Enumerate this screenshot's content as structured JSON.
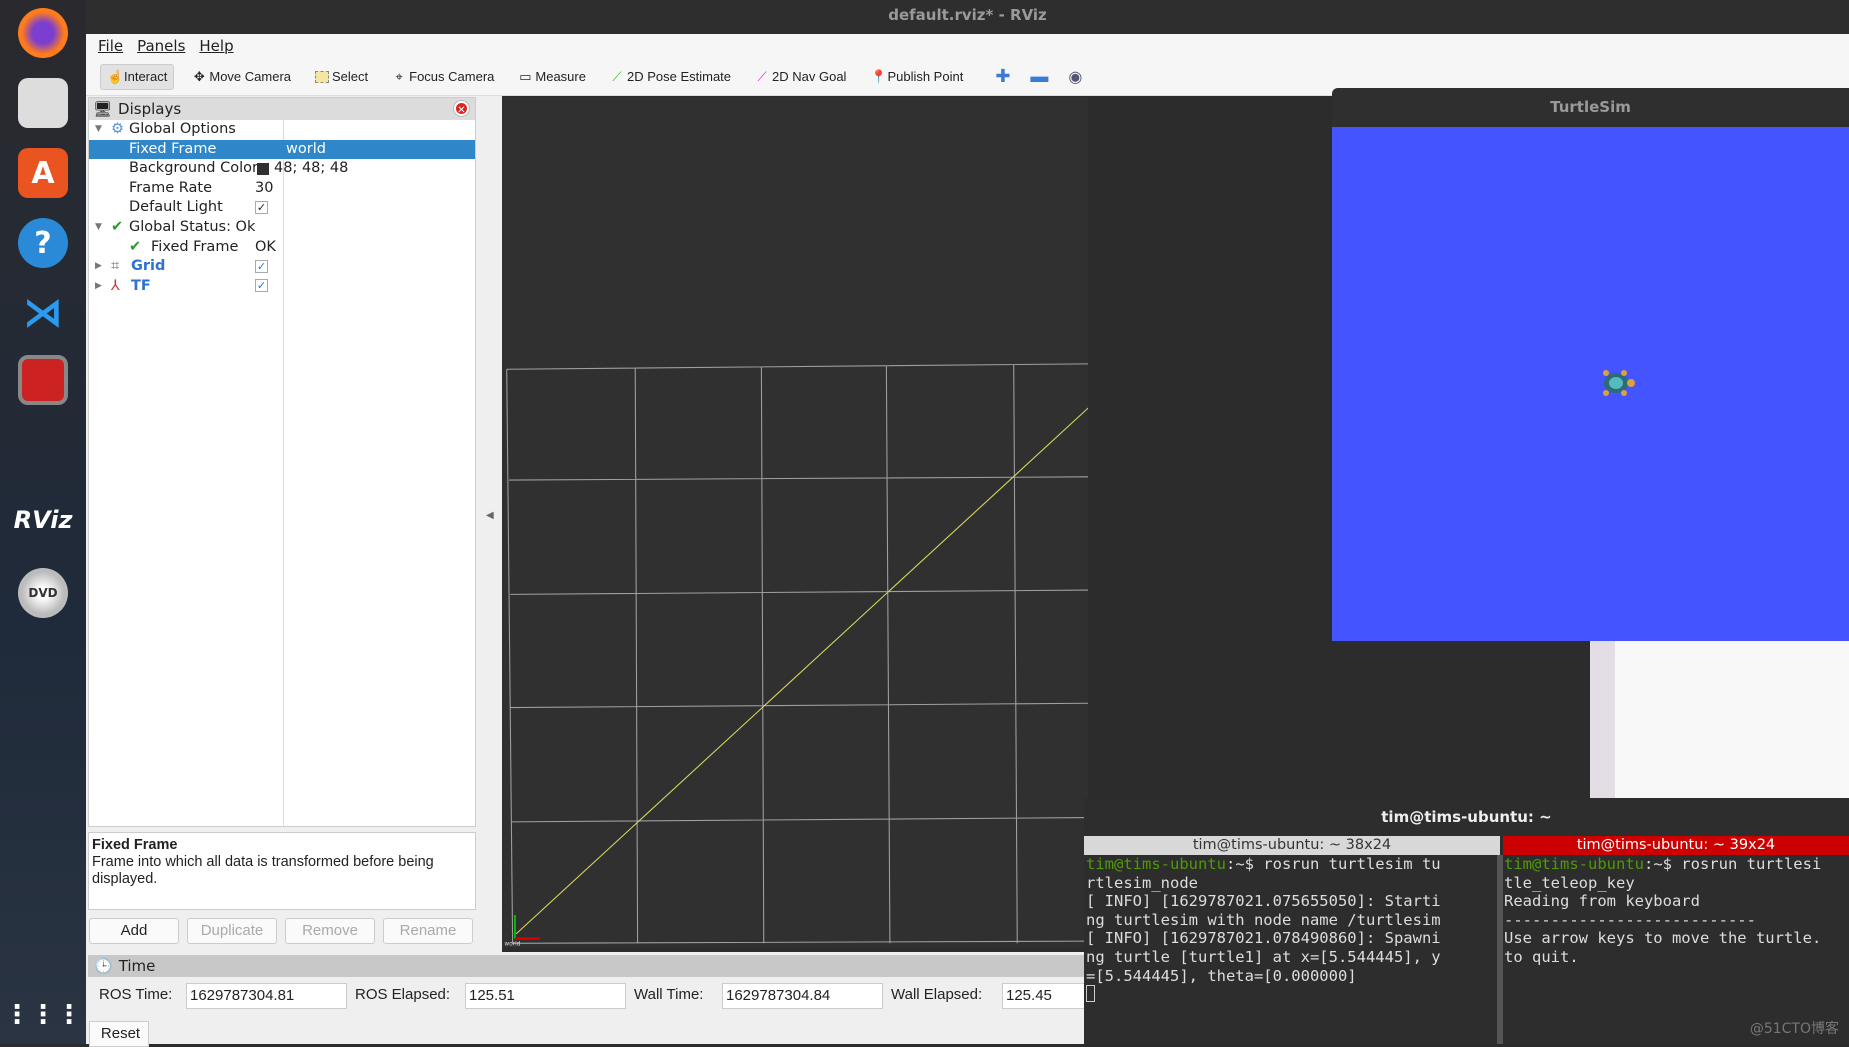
{
  "window_title": "default.rviz* - RViz",
  "menu": [
    "File",
    "Panels",
    "Help"
  ],
  "toolbar": [
    {
      "label": "Interact",
      "icon": "hand-icon",
      "active": true
    },
    {
      "label": "Move Camera",
      "icon": "move-icon"
    },
    {
      "label": "Select",
      "icon": "select-box-icon"
    },
    {
      "label": "Focus Camera",
      "icon": "crosshair-icon"
    },
    {
      "label": "Measure",
      "icon": "ruler-icon"
    },
    {
      "label": "2D Pose Estimate",
      "icon": "green-arrow-icon"
    },
    {
      "label": "2D Nav Goal",
      "icon": "pink-arrow-icon"
    },
    {
      "label": "Publish Point",
      "icon": "pin-icon"
    }
  ],
  "displays": {
    "title": "Displays",
    "rows": [
      {
        "key": "Global Options"
      },
      {
        "key": "Fixed Frame",
        "value": "world"
      },
      {
        "key": "Background Color",
        "value": "48; 48; 48",
        "color": "#303030"
      },
      {
        "key": "Frame Rate",
        "value": "30"
      },
      {
        "key": "Default Light",
        "checked": true
      },
      {
        "key": "Global Status: Ok"
      },
      {
        "key": "Fixed Frame",
        "value": "OK"
      },
      {
        "key": "Grid",
        "checked": true
      },
      {
        "key": "TF",
        "checked": true
      }
    ],
    "description_title": "Fixed Frame",
    "description": "Frame into which all data is transformed before being displayed.",
    "buttons": [
      "Add",
      "Duplicate",
      "Remove",
      "Rename"
    ]
  },
  "view": {
    "frame_labels": [
      "turtle1",
      "world"
    ],
    "background": "#303030",
    "path_color": "#d8d860"
  },
  "time": {
    "title": "Time",
    "ros_time_label": "ROS Time:",
    "ros_time": "1629787304.81",
    "ros_elapsed_label": "ROS Elapsed:",
    "ros_elapsed": "125.51",
    "wall_time_label": "Wall Time:",
    "wall_time": "1629787304.84",
    "wall_elapsed_label": "Wall Elapsed:",
    "wall_elapsed": "125.45",
    "reset": "Reset"
  },
  "turtlesim": {
    "title": "TurtleSim",
    "background": "#4455ff"
  },
  "terminal": {
    "title": "tim@tims-ubuntu: ~",
    "tab_left": "tim@tims-ubuntu: ~ 38x24",
    "tab_right": "tim@tims-ubuntu: ~ 39x24",
    "prompt": "tim@tims-ubuntu",
    "left_lines": [
      ":~$ rosrun turtlesim tu",
      "rtlesim_node",
      "[ INFO] [1629787021.075655050]: Starti",
      "ng turtlesim with node name /turtlesim",
      "[ INFO] [1629787021.078490860]: Spawni",
      "ng turtle [turtle1] at x=[5.544445], y",
      "=[5.544445], theta=[0.000000]"
    ],
    "right_lines": [
      ":~$ rosrun turtlesi",
      "tle_teleop_key",
      "Reading from keyboard",
      "---------------------------",
      "Use arrow keys to move the turtle.",
      "to quit."
    ]
  },
  "watermark": "@51CTO博客"
}
